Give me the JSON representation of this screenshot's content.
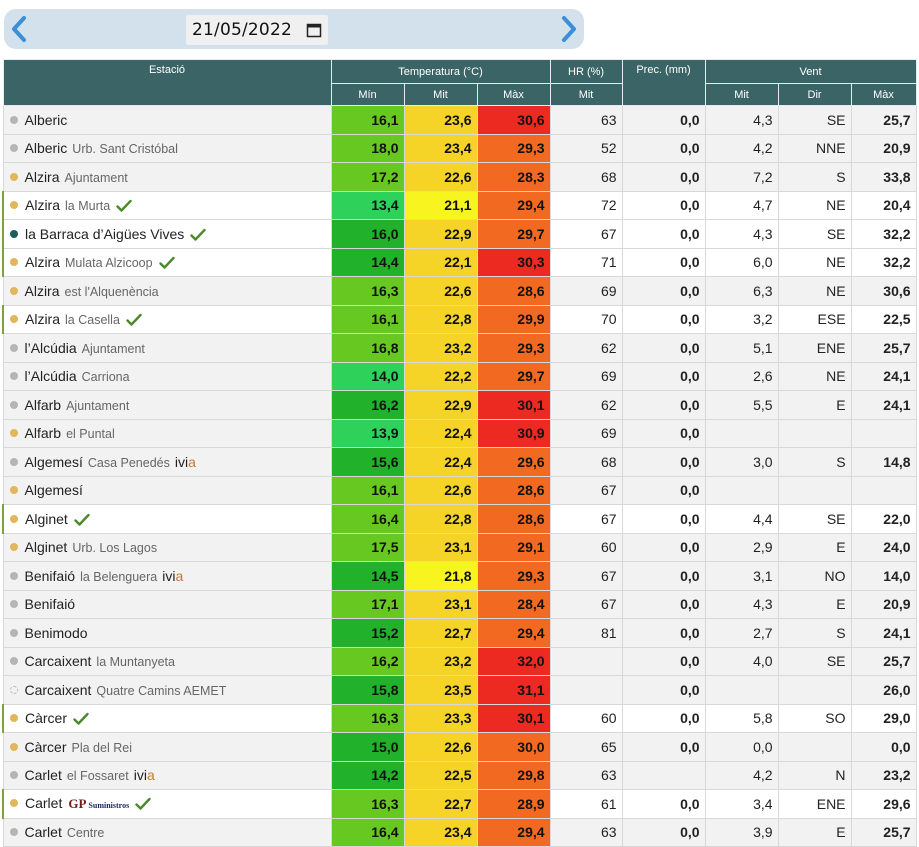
{
  "nav": {
    "date": "21/05/2022"
  },
  "header": {
    "estacio": "Estació",
    "temperatura": "Temperatura (°C)",
    "hr": "HR (%)",
    "prec": "Prec. (mm)",
    "vent": "Vent",
    "min": "Mín",
    "mit": "Mit",
    "max": "Màx",
    "hr_mit": "Mit",
    "vent_mit": "Mit",
    "vent_dir": "Dir",
    "vent_max": "Màx"
  },
  "colors": {
    "header_bg": "#3a6466",
    "dot_gray": "#b5b5b5",
    "dot_yellow": "#e2b65a",
    "dot_teal": "#1e5c5e",
    "check": "#4a8a2a"
  },
  "rows": [
    {
      "name": "Alberic",
      "sub": "",
      "dot": "gray",
      "check": false,
      "min": "16,1",
      "mit": "23,6",
      "max": "30,6",
      "hr": "63",
      "prec": "0,0",
      "vmit": "4,3",
      "dir": "SE",
      "vmax": "25,7",
      "cmin": "#68c822",
      "cmit": "#f5d327",
      "cmax": "#ec2a22"
    },
    {
      "name": "Alberic",
      "sub": "Urb. Sant Cristóbal",
      "dot": "gray",
      "check": false,
      "min": "18,0",
      "mit": "23,4",
      "max": "29,3",
      "hr": "52",
      "prec": "0,0",
      "vmit": "4,2",
      "dir": "NNE",
      "vmax": "20,9",
      "cmin": "#68c822",
      "cmit": "#f5d327",
      "cmax": "#f26a22"
    },
    {
      "name": "Alzira",
      "sub": "Ajuntament",
      "dot": "yellow",
      "check": false,
      "min": "17,2",
      "mit": "22,6",
      "max": "28,3",
      "hr": "68",
      "prec": "0,0",
      "vmit": "7,2",
      "dir": "S",
      "vmax": "33,8",
      "cmin": "#68c822",
      "cmit": "#f5d327",
      "cmax": "#f26a22"
    },
    {
      "name": "Alzira",
      "sub": "la Murta",
      "dot": "yellow",
      "check": true,
      "min": "13,4",
      "mit": "21,1",
      "max": "29,4",
      "hr": "72",
      "prec": "0,0",
      "vmit": "4,7",
      "dir": "NE",
      "vmax": "20,4",
      "cmin": "#2ed159",
      "cmit": "#f7f420",
      "cmax": "#f26a22"
    },
    {
      "name": "la Barraca d’Aigües Vives",
      "sub": "",
      "dot": "teal",
      "check": true,
      "min": "16,0",
      "mit": "22,9",
      "max": "29,7",
      "hr": "67",
      "prec": "0,0",
      "vmit": "4,3",
      "dir": "SE",
      "vmax": "32,2",
      "cmin": "#22b12a",
      "cmit": "#f5d327",
      "cmax": "#f26a22"
    },
    {
      "name": "Alzira",
      "sub": "Mulata Alzicoop",
      "dot": "yellow",
      "check": true,
      "min": "14,4",
      "mit": "22,1",
      "max": "30,3",
      "hr": "71",
      "prec": "0,0",
      "vmit": "6,0",
      "dir": "NE",
      "vmax": "32,2",
      "cmin": "#22b12a",
      "cmit": "#f5d327",
      "cmax": "#ec2a22"
    },
    {
      "name": "Alzira",
      "sub": "est l'Alquenència",
      "dot": "yellow",
      "check": false,
      "min": "16,3",
      "mit": "22,6",
      "max": "28,6",
      "hr": "69",
      "prec": "0,0",
      "vmit": "6,3",
      "dir": "NE",
      "vmax": "30,6",
      "cmin": "#68c822",
      "cmit": "#f5d327",
      "cmax": "#f26a22"
    },
    {
      "name": "Alzira",
      "sub": "la Casella",
      "dot": "yellow",
      "check": true,
      "min": "16,1",
      "mit": "22,8",
      "max": "29,9",
      "hr": "70",
      "prec": "0,0",
      "vmit": "3,2",
      "dir": "ESE",
      "vmax": "22,5",
      "cmin": "#68c822",
      "cmit": "#f5d327",
      "cmax": "#f26a22"
    },
    {
      "name": "l’Alcúdia",
      "sub": "Ajuntament",
      "dot": "gray",
      "check": false,
      "min": "16,8",
      "mit": "23,2",
      "max": "29,3",
      "hr": "62",
      "prec": "0,0",
      "vmit": "5,1",
      "dir": "ENE",
      "vmax": "25,7",
      "cmin": "#68c822",
      "cmit": "#f5d327",
      "cmax": "#f26a22"
    },
    {
      "name": "l’Alcúdia",
      "sub": "Carriona",
      "dot": "gray",
      "check": false,
      "min": "14,0",
      "mit": "22,2",
      "max": "29,7",
      "hr": "69",
      "prec": "0,0",
      "vmit": "2,6",
      "dir": "NE",
      "vmax": "24,1",
      "cmin": "#2ed159",
      "cmit": "#f5d327",
      "cmax": "#f26a22"
    },
    {
      "name": "Alfarb",
      "sub": "Ajuntament",
      "dot": "gray",
      "check": false,
      "min": "16,2",
      "mit": "22,9",
      "max": "30,1",
      "hr": "62",
      "prec": "0,0",
      "vmit": "5,5",
      "dir": "E",
      "vmax": "24,1",
      "cmin": "#22b12a",
      "cmit": "#f5d327",
      "cmax": "#ec2a22"
    },
    {
      "name": "Alfarb",
      "sub": "el Puntal",
      "dot": "yellow",
      "check": false,
      "min": "13,9",
      "mit": "22,4",
      "max": "30,9",
      "hr": "69",
      "prec": "0,0",
      "vmit": "",
      "dir": "",
      "vmax": "",
      "cmin": "#2ed159",
      "cmit": "#f5d327",
      "cmax": "#ec2a22"
    },
    {
      "name": "Algemesí",
      "sub": "Casa Penedés",
      "dot": "gray",
      "check": false,
      "ivia": true,
      "min": "15,6",
      "mit": "22,4",
      "max": "29,6",
      "hr": "68",
      "prec": "0,0",
      "vmit": "3,0",
      "dir": "S",
      "vmax": "14,8",
      "cmin": "#22b12a",
      "cmit": "#f5d327",
      "cmax": "#f26a22"
    },
    {
      "name": "Algemesí",
      "sub": "",
      "dot": "yellow",
      "check": false,
      "min": "16,1",
      "mit": "22,6",
      "max": "28,6",
      "hr": "67",
      "prec": "0,0",
      "vmit": "",
      "dir": "",
      "vmax": "",
      "cmin": "#68c822",
      "cmit": "#f5d327",
      "cmax": "#f26a22"
    },
    {
      "name": "Alginet",
      "sub": "",
      "dot": "yellow",
      "check": true,
      "min": "16,4",
      "mit": "22,8",
      "max": "28,6",
      "hr": "67",
      "prec": "0,0",
      "vmit": "4,4",
      "dir": "SE",
      "vmax": "22,0",
      "cmin": "#68c822",
      "cmit": "#f5d327",
      "cmax": "#f26a22"
    },
    {
      "name": "Alginet",
      "sub": "Urb. Los Lagos",
      "dot": "yellow",
      "check": false,
      "min": "17,5",
      "mit": "23,1",
      "max": "29,1",
      "hr": "60",
      "prec": "0,0",
      "vmit": "2,9",
      "dir": "E",
      "vmax": "24,0",
      "cmin": "#68c822",
      "cmit": "#f5d327",
      "cmax": "#f26a22"
    },
    {
      "name": "Benifaió",
      "sub": "la Belenguera",
      "dot": "gray",
      "check": false,
      "ivia": true,
      "min": "14,5",
      "mit": "21,8",
      "max": "29,3",
      "hr": "67",
      "prec": "0,0",
      "vmit": "3,1",
      "dir": "NO",
      "vmax": "14,0",
      "cmin": "#22b12a",
      "cmit": "#f7f420",
      "cmax": "#f26a22"
    },
    {
      "name": "Benifaió",
      "sub": "",
      "dot": "gray",
      "check": false,
      "min": "17,1",
      "mit": "23,1",
      "max": "28,4",
      "hr": "67",
      "prec": "0,0",
      "vmit": "4,3",
      "dir": "E",
      "vmax": "20,9",
      "cmin": "#68c822",
      "cmit": "#f5d327",
      "cmax": "#f26a22"
    },
    {
      "name": "Benimodo",
      "sub": "",
      "dot": "gray",
      "check": false,
      "min": "15,2",
      "mit": "22,7",
      "max": "29,4",
      "hr": "81",
      "prec": "0,0",
      "vmit": "2,7",
      "dir": "S",
      "vmax": "24,1",
      "cmin": "#22b12a",
      "cmit": "#f5d327",
      "cmax": "#f26a22"
    },
    {
      "name": "Carcaixent",
      "sub": "la Muntanyeta",
      "dot": "gray",
      "check": false,
      "min": "16,2",
      "mit": "23,2",
      "max": "32,0",
      "hr": "",
      "prec": "0,0",
      "vmit": "4,0",
      "dir": "SE",
      "vmax": "25,7",
      "cmin": "#68c822",
      "cmit": "#f5d327",
      "cmax": "#ec2a22"
    },
    {
      "name": "Carcaixent",
      "sub": "Quatre Camins AEMET",
      "dot": "outline",
      "check": false,
      "min": "15,8",
      "mit": "23,5",
      "max": "31,1",
      "hr": "",
      "prec": "0,0",
      "vmit": "",
      "dir": "",
      "vmax": "26,0",
      "cmin": "#22b12a",
      "cmit": "#f5d327",
      "cmax": "#ec2a22"
    },
    {
      "name": "Càrcer",
      "sub": "",
      "dot": "yellow",
      "check": true,
      "min": "16,3",
      "mit": "23,3",
      "max": "30,1",
      "hr": "60",
      "prec": "0,0",
      "vmit": "5,8",
      "dir": "SO",
      "vmax": "29,0",
      "cmin": "#68c822",
      "cmit": "#f5d327",
      "cmax": "#ec2a22"
    },
    {
      "name": "Càrcer",
      "sub": "Pla del Rei",
      "dot": "yellow",
      "check": false,
      "min": "15,0",
      "mit": "22,6",
      "max": "30,0",
      "hr": "65",
      "prec": "0,0",
      "vmit": "0,0",
      "dir": "",
      "vmax": "0,0",
      "cmin": "#22b12a",
      "cmit": "#f5d327",
      "cmax": "#f26a22"
    },
    {
      "name": "Carlet",
      "sub": "el Fossaret",
      "dot": "gray",
      "check": false,
      "ivia": true,
      "min": "14,2",
      "mit": "22,5",
      "max": "29,8",
      "hr": "63",
      "prec": "",
      "vmit": "4,2",
      "dir": "N",
      "vmax": "23,2",
      "cmin": "#22b12a",
      "cmit": "#f5d327",
      "cmax": "#f26a22"
    },
    {
      "name": "Carlet",
      "sub": "",
      "dot": "yellow",
      "check": true,
      "gp": true,
      "min": "16,3",
      "mit": "22,7",
      "max": "28,9",
      "hr": "61",
      "prec": "0,0",
      "vmit": "3,4",
      "dir": "ENE",
      "vmax": "29,6",
      "cmin": "#68c822",
      "cmit": "#f5d327",
      "cmax": "#f26a22"
    },
    {
      "name": "Carlet",
      "sub": "Centre",
      "dot": "gray",
      "check": false,
      "min": "16,4",
      "mit": "23,4",
      "max": "29,4",
      "hr": "63",
      "prec": "0,0",
      "vmit": "3,9",
      "dir": "E",
      "vmax": "25,7",
      "cmin": "#68c822",
      "cmit": "#f5d327",
      "cmax": "#f26a22"
    }
  ],
  "badges": {
    "ivia_a": "ivi",
    "ivia_b": "a",
    "gp": "GP",
    "gp_sub": "Suministros"
  }
}
